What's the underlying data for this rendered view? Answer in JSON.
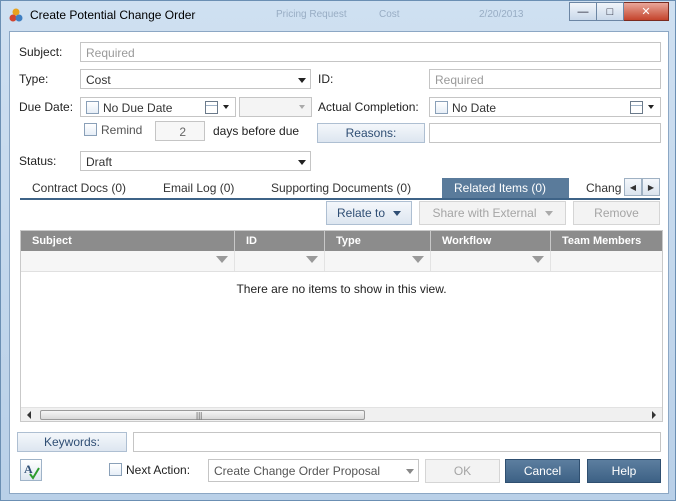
{
  "window": {
    "title": "Create Potential Change Order",
    "ghost_texts": [
      "Pricing Request",
      "Cost",
      "2/20/2013"
    ],
    "controls": {
      "minimize": "—",
      "maximize": "□",
      "close": "✕"
    }
  },
  "form": {
    "subject": {
      "label": "Subject:",
      "placeholder": "Required"
    },
    "type": {
      "label": "Type:",
      "value": "Cost"
    },
    "id": {
      "label": "ID:",
      "placeholder": "Required"
    },
    "due_date": {
      "label": "Due Date:",
      "value": "No Due Date"
    },
    "actual_completion": {
      "label": "Actual Completion:",
      "value": "No Date"
    },
    "remind": {
      "label": "Remind",
      "days": "2",
      "suffix": "days before due"
    },
    "reasons_button": "Reasons:",
    "status": {
      "label": "Status:",
      "value": "Draft"
    }
  },
  "tabs": [
    {
      "label": "Contract Docs (0)"
    },
    {
      "label": "Email Log (0)"
    },
    {
      "label": "Supporting Documents (0)"
    },
    {
      "label": "Related Items (0)"
    },
    {
      "label": "Chang"
    }
  ],
  "toolbar": {
    "relate_to": "Relate to",
    "share_with_external": "Share with External",
    "remove": "Remove"
  },
  "grid": {
    "columns": [
      "Subject",
      "ID",
      "Type",
      "Workflow",
      "Team Members"
    ],
    "empty_message": "There are no items to show in this view."
  },
  "footer": {
    "keywords_button": "Keywords:",
    "next_action_label": "Next Action:",
    "next_action_value": "Create Change Order Proposal",
    "ok": "OK",
    "cancel": "Cancel",
    "help": "Help"
  },
  "colors": {
    "active_tab": "#5a7b9b",
    "grid_header": "#8c8c8c",
    "primary_button": "#3d6185"
  }
}
